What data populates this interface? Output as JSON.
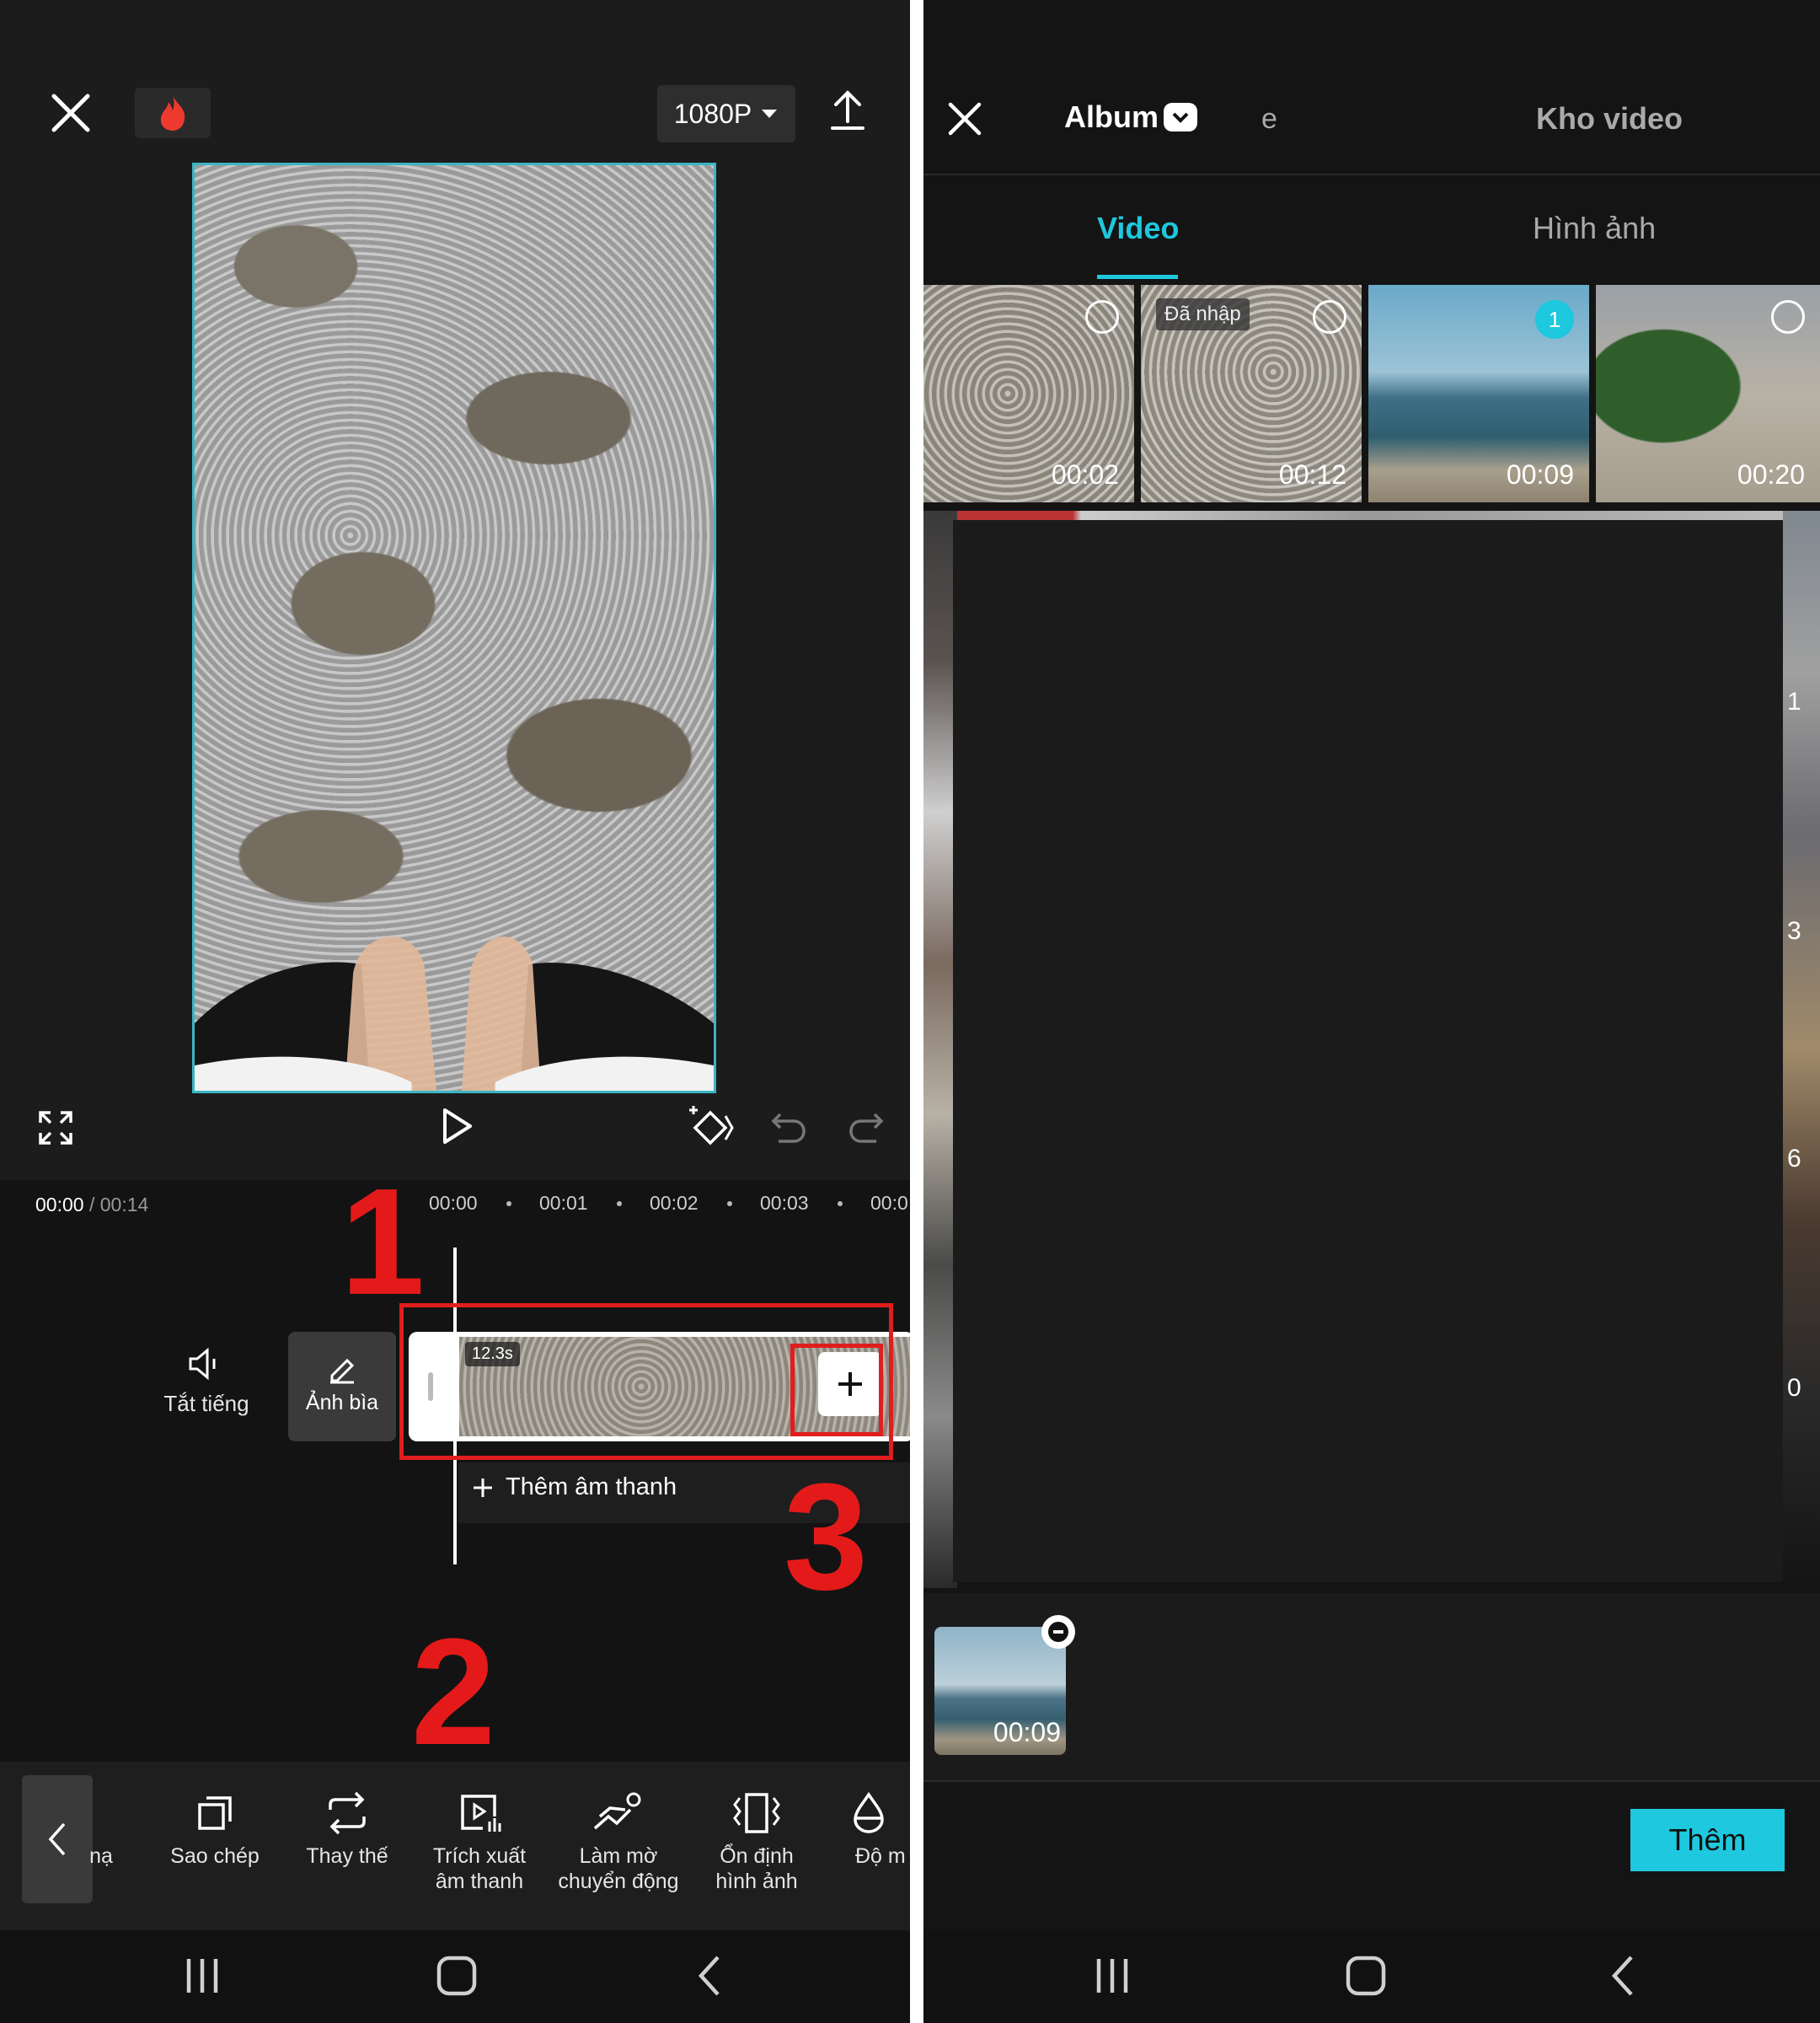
{
  "left": {
    "resolution": "1080P",
    "time_current": "00:00",
    "time_separator": "/",
    "time_total": "00:14",
    "ruler": [
      "00:00",
      "00:01",
      "00:02",
      "00:03",
      "00:0"
    ],
    "mute_label": "Tắt tiếng",
    "cover_label": "Ảnh bìa",
    "clip_duration": "12.3s",
    "add_audio_label": "Thêm âm thanh",
    "annotations": [
      "1",
      "2",
      "3"
    ],
    "toolbar": [
      {
        "label1": "nạ",
        "label2": ""
      },
      {
        "label1": "Sao chép",
        "label2": ""
      },
      {
        "label1": "Thay thế",
        "label2": ""
      },
      {
        "label1": "Trích xuất",
        "label2": "âm thanh"
      },
      {
        "label1": "Làm mờ",
        "label2": "chuyển động"
      },
      {
        "label1": "Ổn định",
        "label2": "hình ảnh"
      },
      {
        "label1": "Độ m",
        "label2": ""
      }
    ]
  },
  "right": {
    "tab_album": "Album",
    "tab_partial": "e",
    "tab_stock": "Kho video",
    "subtab_video": "Video",
    "subtab_image": "Hình ảnh",
    "thumbs": [
      {
        "duration": "00:02"
      },
      {
        "duration": "00:12",
        "badge": "Đã nhập"
      },
      {
        "duration": "00:09",
        "selected_index": "1"
      },
      {
        "duration": "00:20"
      }
    ],
    "edge_numbers": [
      "1",
      "3",
      "6",
      "0"
    ],
    "selected_duration": "00:09",
    "add_button": "Thêm"
  },
  "colors": {
    "accent": "#1ec8de",
    "annotation_red": "#e41a1a",
    "frame_border": "#3bb6c4"
  }
}
